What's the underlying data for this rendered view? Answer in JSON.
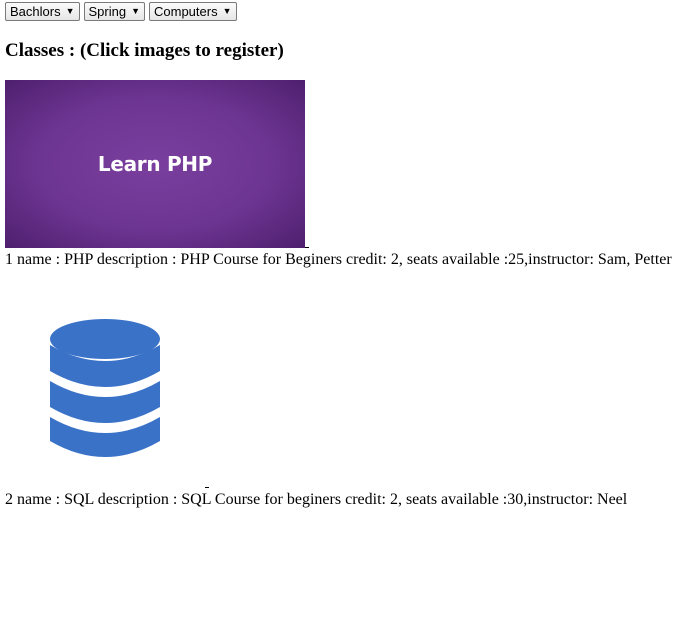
{
  "filters": {
    "degree": {
      "selected": "Bachlors"
    },
    "semester": {
      "selected": "Spring"
    },
    "department": {
      "selected": "Computers"
    }
  },
  "heading": "Classes : (Click images to register)",
  "courses": [
    {
      "image_text": "Learn PHP",
      "image_icon": "learn-php-banner",
      "info": "1 name : PHP description : PHP Course for Beginers credit: 2, seats available :25,instructor: Sam, Petter"
    },
    {
      "image_icon": "database-icon",
      "info": "2 name : SQL description : SQL Course for beginers credit: 2, seats available :30,instructor: Neel"
    }
  ],
  "colors": {
    "php_banner": "#6d3592",
    "database_icon": "#3a72c8"
  }
}
